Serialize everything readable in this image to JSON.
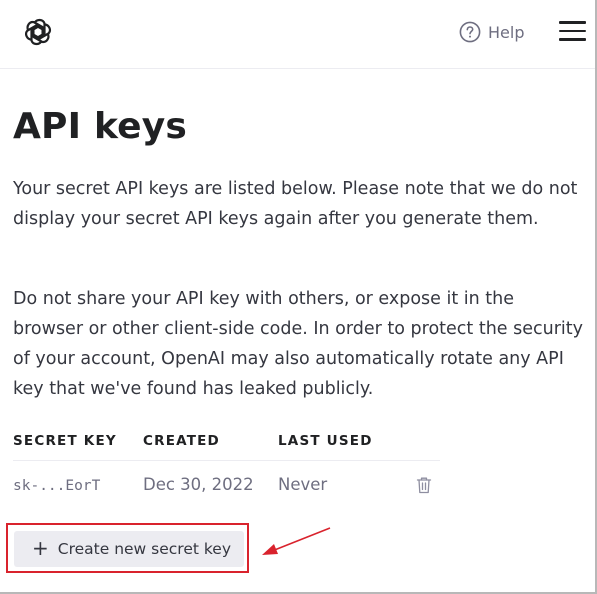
{
  "header": {
    "help_label": "Help",
    "logo_icon": "openai-logo-icon",
    "help_icon": "question-circle-icon",
    "menu_icon": "hamburger-menu-icon"
  },
  "page": {
    "title": "API keys",
    "paragraph1": "Your secret API keys are listed below. Please note that we do not display your secret API keys again after you generate them.",
    "paragraph2": "Do not share your API key with others, or expose it in the browser or other client-side code. In order to protect the security of your account, OpenAI may also automatically rotate any API key that we've found has leaked publicly."
  },
  "table": {
    "headers": [
      "SECRET KEY",
      "CREATED",
      "LAST USED"
    ],
    "rows": [
      {
        "key": "sk-...EorT",
        "created": "Dec 30, 2022",
        "last_used": "Never",
        "action_icon": "trash-icon"
      }
    ]
  },
  "create_button": {
    "icon": "+",
    "label": "Create new secret key"
  },
  "annotation": {
    "highlight_color": "#d9232d"
  }
}
